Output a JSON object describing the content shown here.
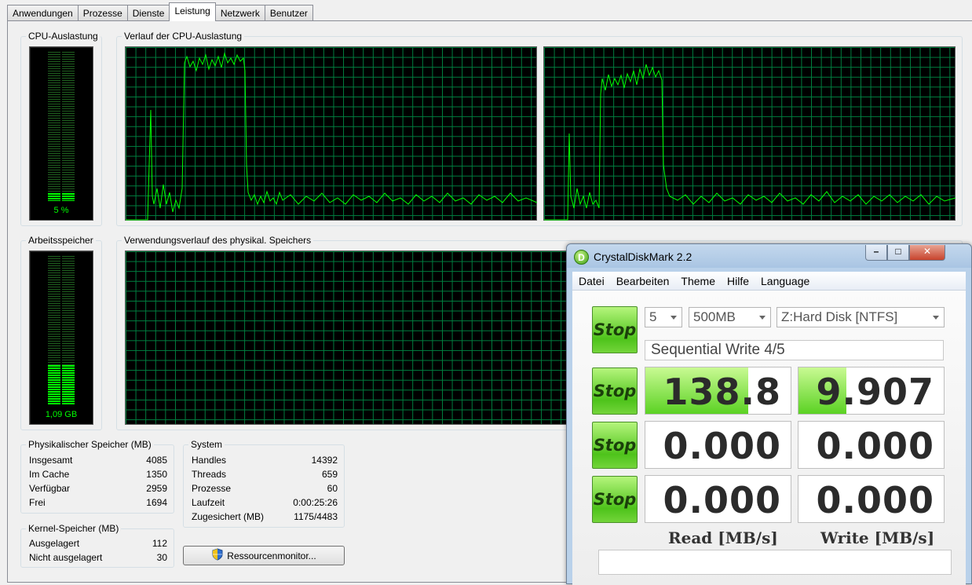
{
  "tabs": [
    "Anwendungen",
    "Prozesse",
    "Dienste",
    "Leistung",
    "Netzwerk",
    "Benutzer"
  ],
  "active_tab": "Leistung",
  "cpu": {
    "title": "CPU-Auslastung",
    "value_label": "5 %",
    "percent": 5,
    "history_title": "Verlauf der CPU-Auslastung"
  },
  "memory": {
    "title": "Arbeitsspeicher",
    "value_label": "1,09 GB",
    "percent": 27,
    "history_title": "Verwendungsverlauf des physikal. Speichers"
  },
  "physical": {
    "title": "Physikalischer Speicher (MB)",
    "rows": [
      {
        "label": "Insgesamt",
        "value": "4085"
      },
      {
        "label": "Im Cache",
        "value": "1350"
      },
      {
        "label": "Verfügbar",
        "value": "2959"
      },
      {
        "label": "Frei",
        "value": "1694"
      }
    ]
  },
  "kernel": {
    "title": "Kernel-Speicher (MB)",
    "rows": [
      {
        "label": "Ausgelagert",
        "value": "112"
      },
      {
        "label": "Nicht ausgelagert",
        "value": "30"
      }
    ]
  },
  "system": {
    "title": "System",
    "rows": [
      {
        "label": "Handles",
        "value": "14392"
      },
      {
        "label": "Threads",
        "value": "659"
      },
      {
        "label": "Prozesse",
        "value": "60"
      },
      {
        "label": "Laufzeit",
        "value": "0:00:25:26"
      },
      {
        "label": "Zugesichert (MB)",
        "value": "1175/4483"
      }
    ]
  },
  "resource_button": "Ressourcenmonitor...",
  "cdm": {
    "title": "CrystalDiskMark 2.2",
    "logo_letter": "D",
    "menu": [
      "Datei",
      "Bearbeiten",
      "Theme",
      "Hilfe",
      "Language"
    ],
    "count": "5",
    "size": "500MB",
    "drive": "Z:Hard Disk [NTFS]",
    "status": "Sequential Write 4/5",
    "stop_label": "Stop",
    "read_header": "Read [MB/s]",
    "write_header": "Write [MB/s]",
    "results": [
      {
        "read": "138.8",
        "write": "9.907",
        "read_fill": 0.71,
        "write_fill": 0.33
      },
      {
        "read": "0.000",
        "write": "0.000",
        "read_fill": 0,
        "write_fill": 0
      },
      {
        "read": "0.000",
        "write": "0.000",
        "read_fill": 0,
        "write_fill": 0
      }
    ]
  }
}
